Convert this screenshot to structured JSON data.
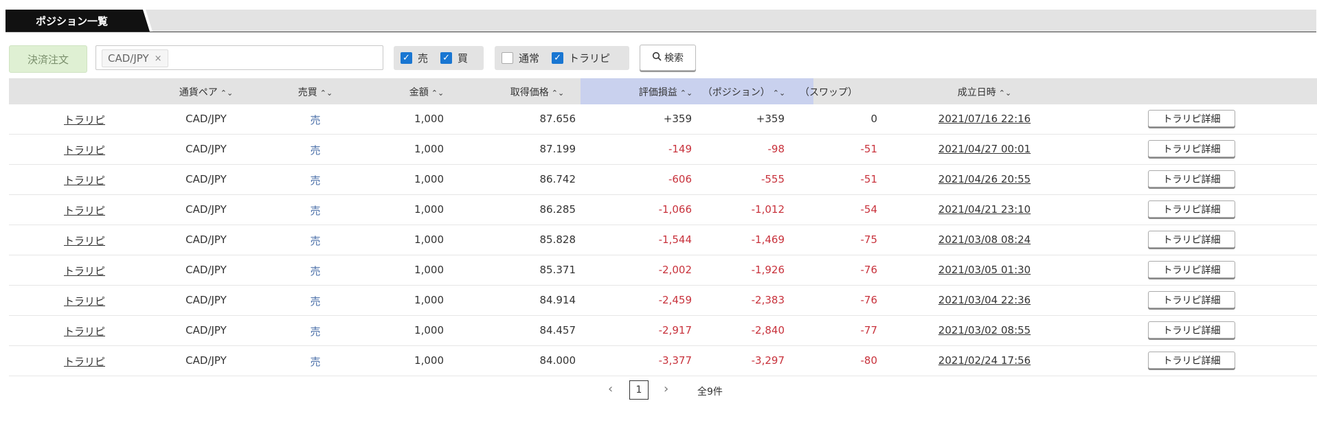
{
  "title": "ポジション一覧",
  "toolbar": {
    "settle_label": "決済注文",
    "filter_chip": "CAD/JPY",
    "chip_remove": "×",
    "sell_label": "売",
    "buy_label": "買",
    "normal_label": "通常",
    "trarepi_label": "トラリピ",
    "search_label": "検索",
    "search_icon": "⚲"
  },
  "table": {
    "headers": {
      "pair": "通貨ペア",
      "side": "売買",
      "amount": "金額",
      "price": "取得価格",
      "pnl": "評価損益",
      "position": "（ポジション）",
      "swap": "（スワップ）",
      "date": "成立日時",
      "sort_icon": "⌃⌄"
    },
    "rows": [
      {
        "type": "トラリピ",
        "pair": "CAD/JPY",
        "side": "売",
        "amount": "1,000",
        "price": "87.656",
        "pnl": "+359",
        "position": "+359",
        "swap": "0",
        "date": "2021/07/16 22:16",
        "detail": "トラリピ詳細"
      },
      {
        "type": "トラリピ",
        "pair": "CAD/JPY",
        "side": "売",
        "amount": "1,000",
        "price": "87.199",
        "pnl": "-149",
        "position": "-98",
        "swap": "-51",
        "date": "2021/04/27 00:01",
        "detail": "トラリピ詳細"
      },
      {
        "type": "トラリピ",
        "pair": "CAD/JPY",
        "side": "売",
        "amount": "1,000",
        "price": "86.742",
        "pnl": "-606",
        "position": "-555",
        "swap": "-51",
        "date": "2021/04/26 20:55",
        "detail": "トラリピ詳細"
      },
      {
        "type": "トラリピ",
        "pair": "CAD/JPY",
        "side": "売",
        "amount": "1,000",
        "price": "86.285",
        "pnl": "-1,066",
        "position": "-1,012",
        "swap": "-54",
        "date": "2021/04/21 23:10",
        "detail": "トラリピ詳細"
      },
      {
        "type": "トラリピ",
        "pair": "CAD/JPY",
        "side": "売",
        "amount": "1,000",
        "price": "85.828",
        "pnl": "-1,544",
        "position": "-1,469",
        "swap": "-75",
        "date": "2021/03/08 08:24",
        "detail": "トラリピ詳細"
      },
      {
        "type": "トラリピ",
        "pair": "CAD/JPY",
        "side": "売",
        "amount": "1,000",
        "price": "85.371",
        "pnl": "-2,002",
        "position": "-1,926",
        "swap": "-76",
        "date": "2021/03/05 01:30",
        "detail": "トラリピ詳細"
      },
      {
        "type": "トラリピ",
        "pair": "CAD/JPY",
        "side": "売",
        "amount": "1,000",
        "price": "84.914",
        "pnl": "-2,459",
        "position": "-2,383",
        "swap": "-76",
        "date": "2021/03/04 22:36",
        "detail": "トラリピ詳細"
      },
      {
        "type": "トラリピ",
        "pair": "CAD/JPY",
        "side": "売",
        "amount": "1,000",
        "price": "84.457",
        "pnl": "-2,917",
        "position": "-2,840",
        "swap": "-77",
        "date": "2021/03/02 08:55",
        "detail": "トラリピ詳細"
      },
      {
        "type": "トラリピ",
        "pair": "CAD/JPY",
        "side": "売",
        "amount": "1,000",
        "price": "84.000",
        "pnl": "-3,377",
        "position": "-3,297",
        "swap": "-80",
        "date": "2021/02/24 17:56",
        "detail": "トラリピ詳細"
      }
    ]
  },
  "pagination": {
    "prev": "‹",
    "next": "›",
    "page": "1",
    "total": "全9件"
  }
}
